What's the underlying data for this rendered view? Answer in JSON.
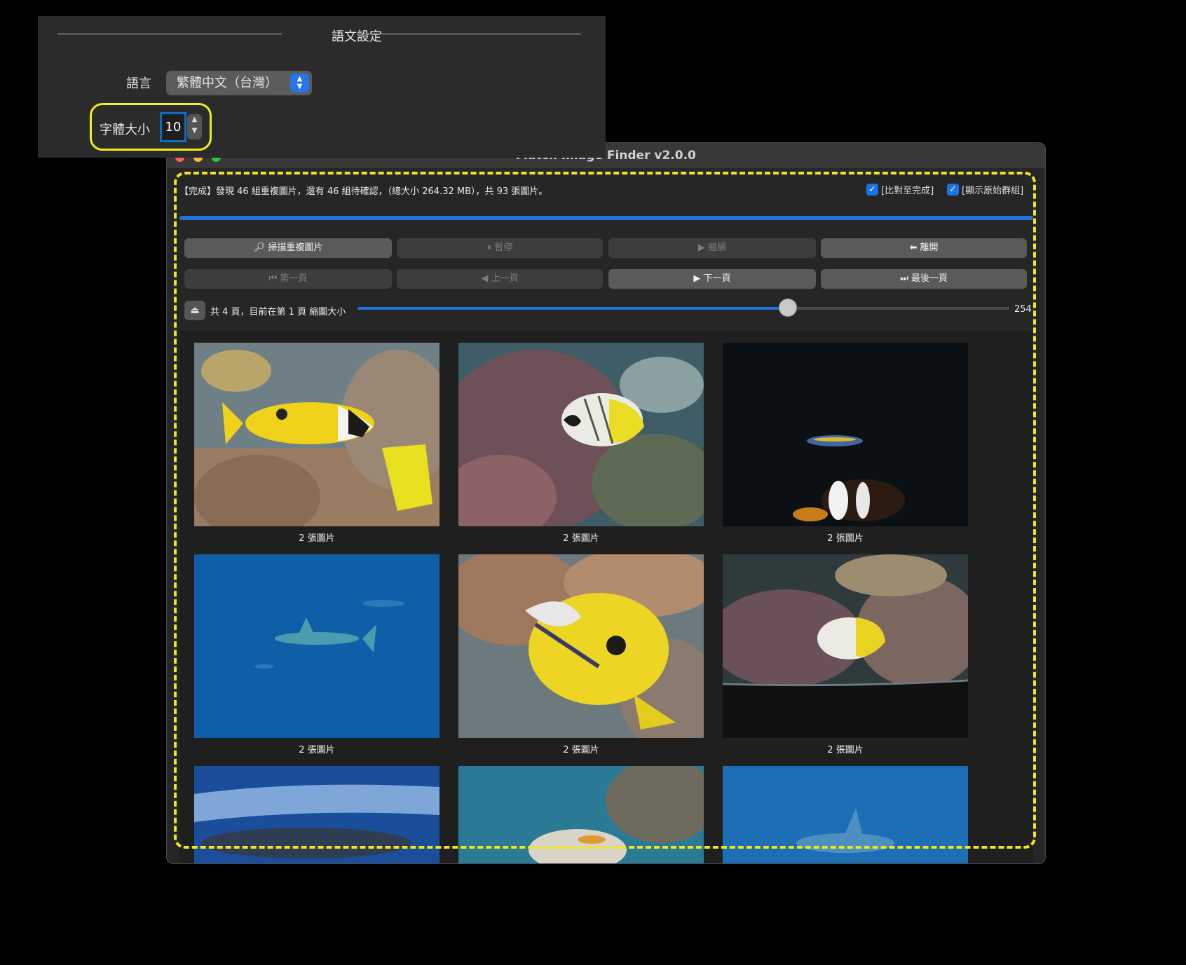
{
  "settings": {
    "section_title": "語文設定",
    "language_label": "語言",
    "language_value": "繁體中文（台灣）",
    "font_size_label": "字體大小",
    "font_size_value": "10"
  },
  "window": {
    "title": "Match Image Finder v2.0.0",
    "status_text": "【完成】發現 46 組重複圖片，還有 46 組待確認，（總大小 264.32 MB），共 93 張圖片。",
    "checkbox_compare": "[比對至完成]",
    "checkbox_show_groups": "[顯示原始群組]",
    "progress_fraction": 1.0,
    "buttons_row1": {
      "scan": "掃描重複圖片",
      "pause": "暫停",
      "resume": "繼續",
      "exit": "離開"
    },
    "buttons_row2": {
      "first": "第一頁",
      "prev": "上一頁",
      "next": "下一頁",
      "last": "最後一頁"
    },
    "page_info": "共 4 頁，目前在第 1 頁 縮圖大小",
    "thumb_size_value": "254",
    "thumb_slider_fraction": 0.66,
    "thumbnails": [
      {
        "caption": "2 張圖片"
      },
      {
        "caption": "2 張圖片"
      },
      {
        "caption": "2 張圖片"
      },
      {
        "caption": "2 張圖片"
      },
      {
        "caption": "2 張圖片"
      },
      {
        "caption": "2 張圖片"
      }
    ]
  },
  "colors": {
    "accent": "#1f73d8",
    "highlight": "#f1ee1a",
    "window_bg": "#262626"
  }
}
